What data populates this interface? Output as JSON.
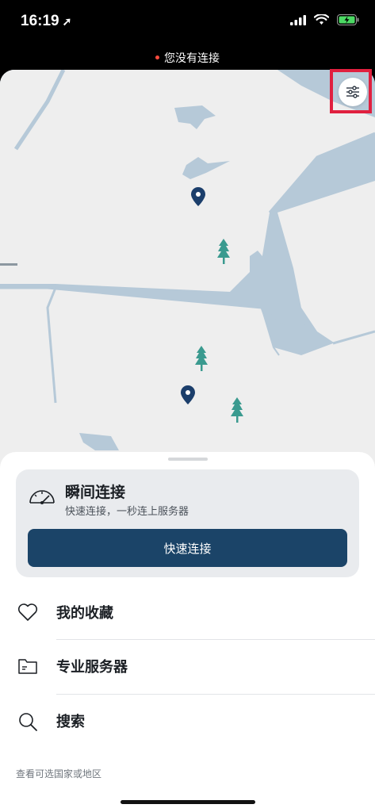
{
  "status_bar": {
    "time": "16:19",
    "location_arrow": "➚",
    "icons": [
      "signal-icon",
      "wifi-icon",
      "battery-charging-icon"
    ]
  },
  "connection": {
    "text": "您没有连接",
    "dot_color": "#ff4b3e"
  },
  "map": {
    "filter_button_icon": "sliders-icon",
    "markers": [
      "location-pin-icon",
      "tree-icon",
      "tree-icon",
      "location-pin-icon",
      "tree-icon"
    ]
  },
  "quick_connect": {
    "icon": "speedometer-icon",
    "title": "瞬间连接",
    "subtitle": "快速连接，一秒连上服务器",
    "button_label": "快速连接"
  },
  "menu": [
    {
      "icon": "heart-icon",
      "label": "我的收藏"
    },
    {
      "icon": "folder-icon",
      "label": "专业服务器"
    },
    {
      "icon": "search-icon",
      "label": "搜索"
    }
  ],
  "footer": {
    "link": "查看可选国家或地区"
  },
  "colors": {
    "accent": "#1b4468",
    "highlight": "#e0203f",
    "water": "#b6c9d8",
    "land": "#eeeeee",
    "tree": "#3a9a8f",
    "pin": "#1b3e6b"
  }
}
